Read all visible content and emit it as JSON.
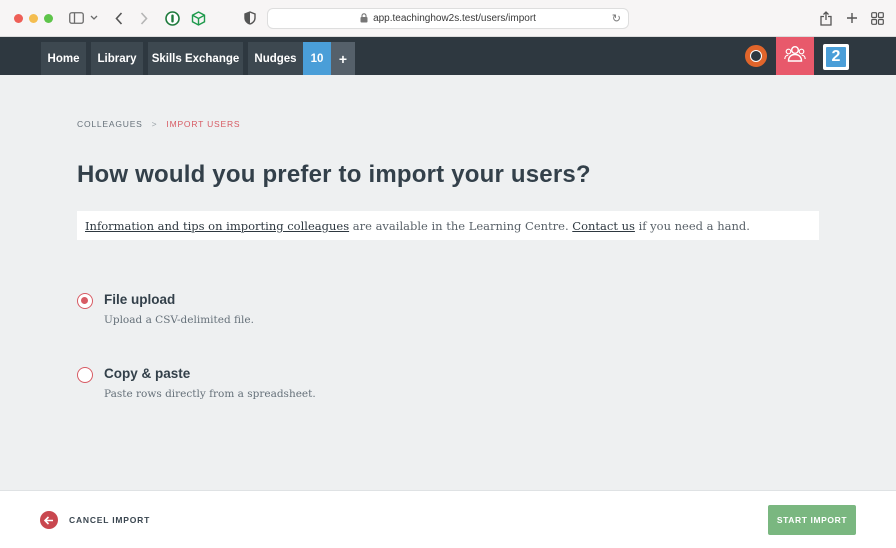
{
  "browser": {
    "url": "app.teachinghow2s.test/users/import"
  },
  "nav": {
    "items": [
      {
        "label": "Home"
      },
      {
        "label": "Library"
      },
      {
        "label": "Skills Exchange"
      },
      {
        "label": "Nudges"
      }
    ],
    "badge": "10",
    "plus": "+",
    "logo": "2"
  },
  "breadcrumb": {
    "parent": "COLLEAGUES",
    "separator": ">",
    "current": "IMPORT USERS"
  },
  "page": {
    "title": "How would you prefer to import your users?"
  },
  "info": {
    "link1": "Information and tips on importing colleagues",
    "text1": " are available in the Learning Centre. ",
    "link2": "Contact us",
    "text2": " if you need a hand."
  },
  "options": [
    {
      "label": "File upload",
      "description": "Upload a CSV-delimited file.",
      "selected": true
    },
    {
      "label": "Copy & paste",
      "description": "Paste rows directly from a spreadsheet.",
      "selected": false
    }
  ],
  "footer": {
    "cancel_label": "CANCEL IMPORT",
    "start_label": "START IMPORT"
  },
  "colors": {
    "accent": "#d75b64",
    "nav_bg": "#2e3840",
    "badge": "#4a9ed8",
    "start_button": "#7ab780"
  }
}
